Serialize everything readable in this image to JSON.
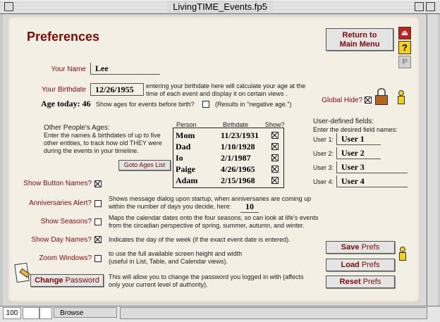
{
  "window": {
    "title": "LivingTIME_Events.fp5"
  },
  "heading": "Preferences",
  "return_button": "Return to\nMain Menu",
  "your_name": {
    "label": "Your Name",
    "value": "Lee"
  },
  "your_birthdate": {
    "label": "Your Birthdate",
    "value": "12/26/1955",
    "note": "entering your birthdate here will calculate your age at the time of each event and display it on certain views ."
  },
  "age_today": "Age today: 46",
  "show_ages_before_birth": {
    "label": "Show ages for events before birth?",
    "note": "(Results in \"negative age.\")"
  },
  "global_hide": {
    "label": "Global Hide?"
  },
  "other_ages": {
    "title": "Other People's Ages:",
    "desc": "Enter the names & birthdates of up to five other entities, to track how old THEY were during the events in your timeline.",
    "goto_button": "Goto Ages List",
    "headers": [
      "Person",
      "Birthdate",
      "Show?"
    ],
    "rows": [
      {
        "person": "Mom",
        "birthdate": "11/23/1931"
      },
      {
        "person": "Dad",
        "birthdate": "1/10/1928"
      },
      {
        "person": "Io",
        "birthdate": "2/1/1987"
      },
      {
        "person": "Paige",
        "birthdate": "4/26/1965"
      },
      {
        "person": "Adam",
        "birthdate": "2/15/1968"
      }
    ]
  },
  "user_fields": {
    "title": "User-defined fields:",
    "desc": "Enter the desired field names:",
    "items": [
      {
        "label": "User 1:",
        "value": "User 1"
      },
      {
        "label": "User 2:",
        "value": "User 2"
      },
      {
        "label": "User 3:",
        "value": "User 3"
      },
      {
        "label": "User 4:",
        "value": "User 4"
      }
    ]
  },
  "show_button_names": {
    "label": "Show Button Names?"
  },
  "anniversaries": {
    "label": "Anniversaries Alert?",
    "note": "Shows message dialog upon startup, when anniversaries are coming up within the number of days you decide, here:",
    "days": "10"
  },
  "show_seasons": {
    "label": "Show Seasons?",
    "note": "Maps the calendar dates onto the four seasons, so can look at life's events from the circadian perspective of spring, summer, autumn, and winter."
  },
  "show_day_names": {
    "label": "Show Day Names?",
    "note": "Indicates the day of the week (if the exact event date is entered)."
  },
  "zoom_windows": {
    "label": "Zoom Windows?",
    "note": "to use the full available screen height and width (useful in List, Table, and Calendar views)."
  },
  "change_password": {
    "label_a": "Change",
    "label_b": "Password",
    "note": "This will allow you to change the password you logged in with (affects only your current level of authority)."
  },
  "prefs_buttons": [
    {
      "a": "Save",
      "b": "Prefs"
    },
    {
      "a": "Load",
      "b": "Prefs"
    },
    {
      "a": "Reset",
      "b": "Prefs"
    }
  ],
  "statusbar": {
    "zoom": "100",
    "mode": "Browse"
  }
}
